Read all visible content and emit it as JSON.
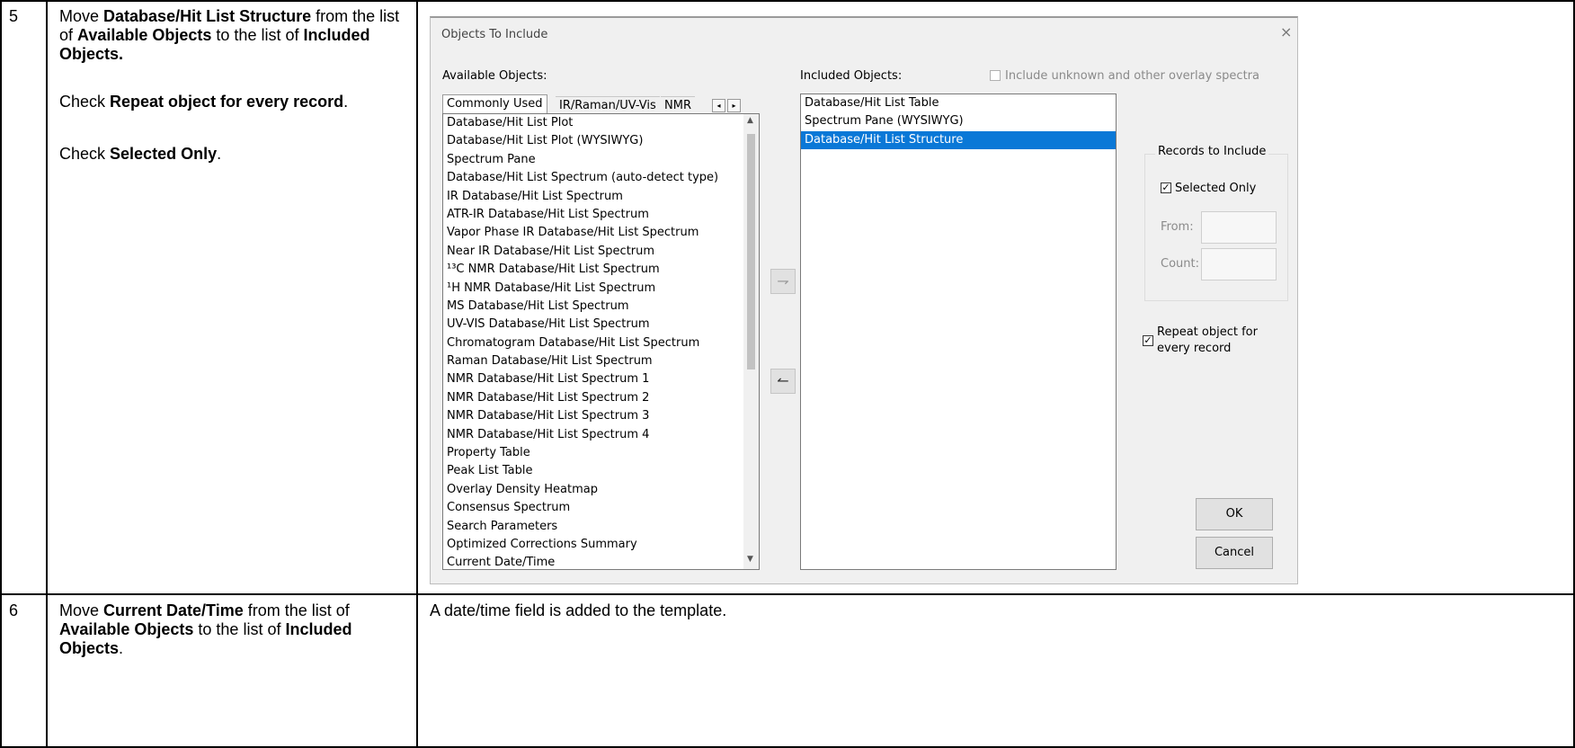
{
  "rows": [
    {
      "step": "5",
      "instructions": [
        [
          {
            "t": "Move "
          },
          {
            "t": "Database/Hit List Structure",
            "b": true
          },
          {
            "t": " from the list of "
          },
          {
            "t": "Available Objects",
            "b": true
          },
          {
            "t": " to the list of "
          },
          {
            "t": "Included Objects.",
            "b": true
          }
        ],
        [
          {
            "t": "Check "
          },
          {
            "t": "Repeat object for every record",
            "b": true
          },
          {
            "t": "."
          }
        ],
        [
          {
            "t": "Check "
          },
          {
            "t": "Selected Only",
            "b": true
          },
          {
            "t": "."
          }
        ]
      ]
    },
    {
      "step": "6",
      "instructions": [
        [
          {
            "t": "Move "
          },
          {
            "t": "Current Date/Time",
            "b": true
          },
          {
            "t": " from the list of "
          },
          {
            "t": "Available Objects",
            "b": true
          },
          {
            "t": " to the list of "
          },
          {
            "t": "Included Objects",
            "b": true
          },
          {
            "t": "."
          }
        ]
      ],
      "result": "A date/time field is added to the template."
    }
  ],
  "dialog": {
    "title": "Objects To Include",
    "close_glyph": "×",
    "available_label": "Available Objects:",
    "included_label": "Included Objects:",
    "include_unknown_label": "Include unknown and other overlay spectra",
    "include_unknown_checked": false,
    "tabs": [
      "Commonly Used",
      "IR/Raman/UV-Vis",
      "NMR"
    ],
    "tab_scroll": [
      "◂",
      "▸"
    ],
    "available_items": [
      "Database/Hit List Plot",
      "Database/Hit List Plot (WYSIWYG)",
      "Spectrum Pane",
      "Database/Hit List Spectrum (auto-detect type)",
      "IR Database/Hit List Spectrum",
      "ATR-IR Database/Hit List Spectrum",
      "Vapor Phase IR Database/Hit List Spectrum",
      "Near IR Database/Hit List Spectrum",
      "¹³C NMR Database/Hit List Spectrum",
      "¹H NMR Database/Hit List Spectrum",
      "MS Database/Hit List Spectrum",
      "UV-VIS Database/Hit List Spectrum",
      "Chromatogram Database/Hit List Spectrum",
      "Raman Database/Hit List Spectrum",
      "NMR Database/Hit List Spectrum 1",
      "NMR Database/Hit List Spectrum 2",
      "NMR Database/Hit List Spectrum 3",
      "NMR Database/Hit List Spectrum 4",
      "Property Table",
      "Peak List Table",
      "Overlay Density Heatmap",
      "Consensus Spectrum",
      "Search Parameters",
      "Optimized Corrections Summary",
      "Current Date/Time"
    ],
    "included_items": [
      "Database/Hit List Table",
      "Spectrum Pane (WYSIWYG)",
      "Database/Hit List Structure"
    ],
    "included_selected": "Database/Hit List Structure",
    "move_right_glyph": "⇁",
    "move_left_glyph": "↼",
    "records_group_label": "Records to Include",
    "selected_only_label": "Selected Only",
    "selected_only_checked": true,
    "from_label": "From:",
    "count_label": "Count:",
    "repeat_label_line1": "Repeat object for",
    "repeat_label_line2": "every record",
    "repeat_checked": true,
    "ok_label": "OK",
    "cancel_label": "Cancel"
  }
}
